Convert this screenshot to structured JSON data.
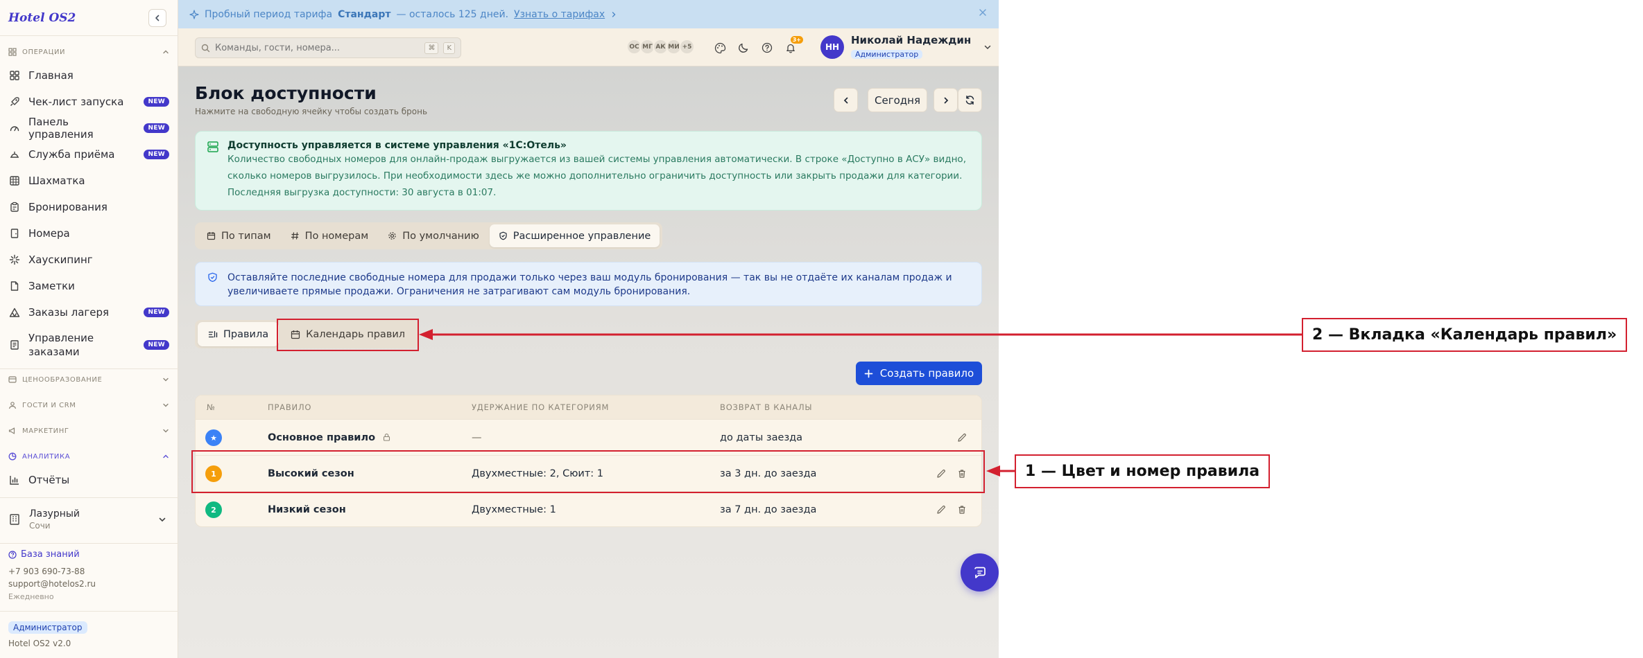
{
  "brand": "Hotel OS2",
  "sidebar": {
    "groups": {
      "operations": "Операции",
      "pricing": "Ценообразование",
      "guests": "Гости и CRM",
      "marketing": "Маркетинг",
      "analytics": "Аналитика"
    },
    "items": [
      {
        "label": "Главная",
        "icon": "grid-icon",
        "badge": ""
      },
      {
        "label": "Чек-лист запуска",
        "icon": "rocket-icon",
        "badge": "NEW"
      },
      {
        "label": "Панель управления",
        "icon": "gauge-icon",
        "badge": "NEW"
      },
      {
        "label": "Служба приёма",
        "icon": "bell-desk-icon",
        "badge": "NEW"
      },
      {
        "label": "Шахматка",
        "icon": "table-icon",
        "badge": ""
      },
      {
        "label": "Бронирования",
        "icon": "clipboard-icon",
        "badge": ""
      },
      {
        "label": "Номера",
        "icon": "door-icon",
        "badge": ""
      },
      {
        "label": "Хаускипинг",
        "icon": "sparkle-icon",
        "badge": ""
      },
      {
        "label": "Заметки",
        "icon": "note-icon",
        "badge": ""
      },
      {
        "label": "Заказы лагеря",
        "icon": "tent-icon",
        "badge": "NEW"
      },
      {
        "label": "Управление заказами",
        "icon": "orders-icon",
        "badge": "NEW"
      }
    ],
    "analytics_items": [
      {
        "label": "Отчёты",
        "icon": "bar-chart-icon"
      }
    ],
    "hotel": {
      "name": "Лазурный",
      "city": "Сочи"
    },
    "knowledge_base": "База знаний",
    "phone": "+7 903 690-73-88",
    "email": "support@hotelos2.ru",
    "hours": "Ежедневно",
    "role": "Администратор",
    "version": "Hotel OS2 v2.0"
  },
  "trial": {
    "prefix": "Пробный период тарифа",
    "plan": "Стандарт",
    "suffix": "— осталось 125 дней.",
    "link": "Узнать о тарифах"
  },
  "topbar": {
    "search_placeholder": "Команды, гости, номера...",
    "shortcut_mod": "⌘",
    "shortcut_key": "K",
    "presence": [
      "ОС",
      "МГ",
      "АК",
      "МИ",
      "+5"
    ],
    "notifications": "3+",
    "user_name": "Николай Надеждин",
    "user_role": "Администратор",
    "user_initials": "НН"
  },
  "page": {
    "title": "Блок доступности",
    "subtitle": "Нажмите на свободную ячейку чтобы создать бронь",
    "today_label": "Сегодня"
  },
  "sync_notice": {
    "title": "Доступность управляется в системе управления «1С:Отель»",
    "lines": [
      "Количество свободных номеров для онлайн-продаж выгружается из вашей системы управления автоматически. В строке «Доступно в АСУ» видно,",
      "сколько номеров выгрузилось. При необходимости здесь же можно дополнительно ограничить доступность или закрыть продажи для категории.",
      "Последняя выгрузка доступности: 30 августа в 01:07."
    ]
  },
  "view_tabs": [
    "По типам",
    "По номерам",
    "По умолчанию",
    "Расширенное управление"
  ],
  "info_notice": {
    "lines": [
      "Оставляйте последние свободные номера для продажи только через ваш модуль бронирования — так вы не отдаёте их каналам продаж и",
      "увеличиваете прямые продажи. Ограничения не затрагивают сам модуль бронирования."
    ]
  },
  "sub_tabs": [
    "Правила",
    "Календарь правил"
  ],
  "create_rule_label": "Создать правило",
  "rules_table": {
    "columns": [
      "№",
      "Правило",
      "Удержание по категориям",
      "Возврат в каналы"
    ],
    "rows": [
      {
        "num": "★",
        "color": "#3b82f6",
        "name": "Основное правило",
        "hold": "—",
        "return": "до даты заезда",
        "locked": true
      },
      {
        "num": "1",
        "color": "#f59e0b",
        "name": "Высокий сезон",
        "hold": "Двухместные: 2, Сюит: 1",
        "return": "за 3 дн. до заезда",
        "locked": false
      },
      {
        "num": "2",
        "color": "#10b981",
        "name": "Низкий сезон",
        "hold": "Двухместные: 1",
        "return": "за 7 дн. до заезда",
        "locked": false
      }
    ]
  },
  "annotations": {
    "callout_1": "1 — Цвет и номер правила",
    "callout_2": "2 — Вкладка «Календарь правил»",
    "accent": "#d3202f"
  }
}
